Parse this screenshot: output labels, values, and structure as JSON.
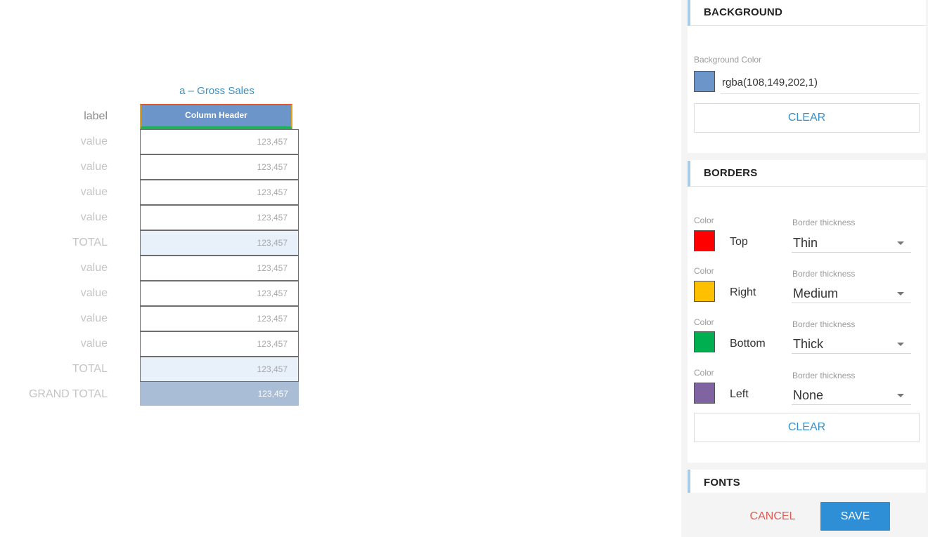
{
  "preview": {
    "column_title": "a – Gross Sales",
    "header_row": {
      "label": "label",
      "cell": "Column Header"
    },
    "rows": [
      {
        "label": "value",
        "value": "123,457",
        "kind": "value"
      },
      {
        "label": "value",
        "value": "123,457",
        "kind": "value"
      },
      {
        "label": "value",
        "value": "123,457",
        "kind": "value"
      },
      {
        "label": "value",
        "value": "123,457",
        "kind": "value"
      },
      {
        "label": "TOTAL",
        "value": "123,457",
        "kind": "total"
      },
      {
        "label": "value",
        "value": "123,457",
        "kind": "value"
      },
      {
        "label": "value",
        "value": "123,457",
        "kind": "value"
      },
      {
        "label": "value",
        "value": "123,457",
        "kind": "value"
      },
      {
        "label": "value",
        "value": "123,457",
        "kind": "value"
      },
      {
        "label": "TOTAL",
        "value": "123,457",
        "kind": "total"
      },
      {
        "label": "GRAND TOTAL",
        "value": "123,457",
        "kind": "grand"
      }
    ]
  },
  "background": {
    "title": "BACKGROUND",
    "color_label": "Background Color",
    "color_value": "rgba(108,149,202,1)",
    "color_hex": "#6c95ca",
    "clear_label": "CLEAR"
  },
  "borders": {
    "title": "BORDERS",
    "color_label": "Color",
    "thickness_label": "Border thickness",
    "items": [
      {
        "side": "Top",
        "color": "#ff0000",
        "thickness": "Thin"
      },
      {
        "side": "Right",
        "color": "#ffc000",
        "thickness": "Medium"
      },
      {
        "side": "Bottom",
        "color": "#00b050",
        "thickness": "Thick"
      },
      {
        "side": "Left",
        "color": "#8064a2",
        "thickness": "None"
      }
    ],
    "clear_label": "CLEAR"
  },
  "fonts": {
    "title": "FONTS"
  },
  "footer": {
    "cancel_label": "CANCEL",
    "save_label": "SAVE"
  }
}
